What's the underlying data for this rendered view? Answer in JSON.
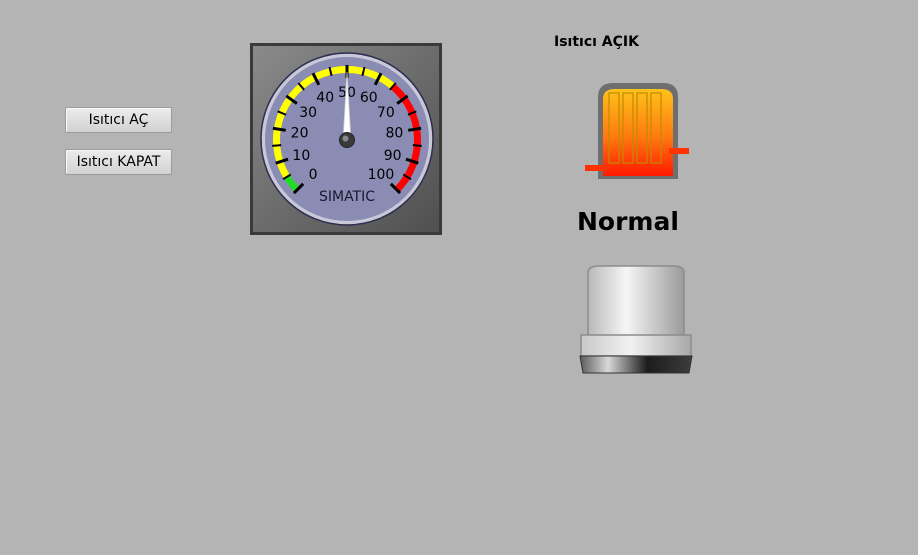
{
  "buttons": {
    "heater_on_label": "Isıtıcı AÇ",
    "heater_off_label": "Isıtıcı KAPAT"
  },
  "gauge": {
    "value": 50,
    "min": 0,
    "max": 100,
    "brand_label": "SIMATIC",
    "tick_labels": [
      "0",
      "10",
      "20",
      "30",
      "40",
      "50",
      "60",
      "70",
      "80",
      "90",
      "100"
    ],
    "band_colors": {
      "green": "#22dd22",
      "yellow": "#ffff00",
      "red": "#ff0000"
    },
    "dial_color": "#8a8cb4"
  },
  "heater": {
    "status_label": "Isıtıcı AÇIK",
    "icon": "heater-icon",
    "body_color_top": "#ffc21a",
    "body_color_bottom": "#ff1800"
  },
  "status": {
    "state_text": "Normal",
    "lamp_icon": "indicator-lamp-icon"
  }
}
